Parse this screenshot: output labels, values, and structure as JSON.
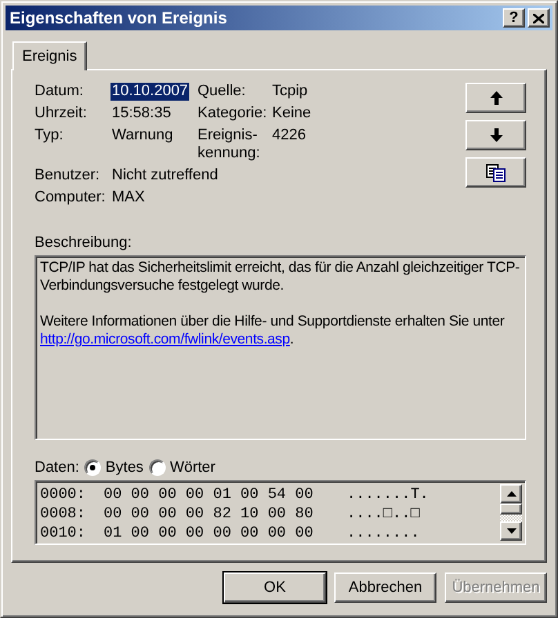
{
  "window": {
    "title": "Eigenschaften von Ereignis",
    "help_button": "?"
  },
  "tabs": [
    {
      "label": "Ereignis",
      "selected": true
    }
  ],
  "field_rows": [
    [
      {
        "label": "Datum:",
        "value": "10.10.2007",
        "highlighted": true
      },
      {
        "label": "Quelle:",
        "value": "Tcpip",
        "highlighted": false
      }
    ],
    [
      {
        "label": "Uhrzeit:",
        "value": "15:58:35",
        "highlighted": false
      },
      {
        "label": "Kategorie:",
        "value": "Keine",
        "highlighted": false
      }
    ],
    [
      {
        "label": "Typ:",
        "value": "Warnung",
        "highlighted": false
      },
      {
        "label": "Ereignis-kennung:",
        "value": "4226",
        "highlighted": false
      }
    ],
    [
      {
        "label": "Benutzer:",
        "value": "Nicht zutreffend",
        "highlighted": false
      }
    ],
    [
      {
        "label": "Computer:",
        "value": "MAX",
        "highlighted": false
      }
    ]
  ],
  "nav_buttons": [
    {
      "kind": "up"
    },
    {
      "kind": "down"
    },
    {
      "kind": "copy"
    }
  ],
  "description": {
    "label": "Beschreibung:",
    "paragraph_1": "TCP/IP hat das Sicherheitslimit erreicht, das für die Anzahl gleichzeitiger TCP-Verbindungsversuche festgelegt wurde.",
    "paragraph_2": "Weitere Informationen über die Hilfe- und Supportdienste erhalten Sie unter",
    "link": "http://go.microsoft.com/fwlink/events.asp",
    "after_link": "."
  },
  "data": {
    "label": "Daten:",
    "options": [
      {
        "label": "Bytes",
        "selected": true
      },
      {
        "label": "Wörter",
        "selected": false
      }
    ],
    "lines": [
      {
        "offset": "0000:",
        "bytes": "00 00 00 00 01 00 54 00",
        "ascii": ".......T."
      },
      {
        "offset": "0008:",
        "bytes": "00 00 00 00 82 10 00 80",
        "ascii": "....□..□"
      },
      {
        "offset": "0010:",
        "bytes": "01 00 00 00 00 00 00 00",
        "ascii": "........"
      }
    ]
  },
  "buttons": [
    {
      "label": "OK",
      "default": true,
      "disabled": false
    },
    {
      "label": "Abbrechen",
      "default": false,
      "disabled": false
    },
    {
      "label": "Übernehmen",
      "default": false,
      "disabled": true
    }
  ]
}
